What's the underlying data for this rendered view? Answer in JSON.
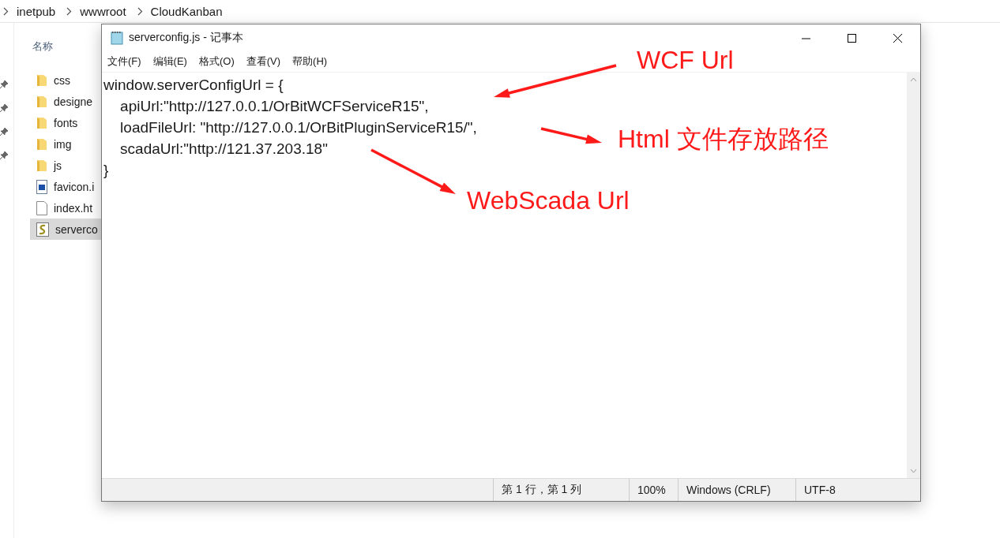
{
  "explorer": {
    "breadcrumb": [
      "inetpub",
      "wwwroot",
      "CloudKanban"
    ],
    "column_header": "名称",
    "files": [
      {
        "name": "css",
        "kind": "folder",
        "selected": false
      },
      {
        "name": "designe",
        "kind": "folder",
        "selected": false
      },
      {
        "name": "fonts",
        "kind": "folder",
        "selected": false
      },
      {
        "name": "img",
        "kind": "folder",
        "selected": false
      },
      {
        "name": "js",
        "kind": "folder",
        "selected": false
      },
      {
        "name": "favicon.i",
        "kind": "image",
        "selected": false
      },
      {
        "name": "index.ht",
        "kind": "file",
        "selected": false
      },
      {
        "name": "serverco",
        "kind": "script",
        "selected": true
      }
    ]
  },
  "notepad": {
    "title": "serverconfig.js - 记事本",
    "menu": [
      "文件(F)",
      "编辑(E)",
      "格式(O)",
      "查看(V)",
      "帮助(H)"
    ],
    "lines": [
      "window.serverConfigUrl = {",
      "    apiUrl:\"http://127.0.0.1/OrBitWCFServiceR15\",",
      "    loadFileUrl: \"http://127.0.0.1/OrBitPluginServiceR15/\",",
      "    scadaUrl:\"http://121.37.203.18\"",
      "}"
    ],
    "status_bar": [
      "第 1 行，第 1 列",
      "100%",
      "Windows (CRLF)",
      "UTF-8"
    ]
  },
  "annotations": [
    {
      "text": "WCF Url"
    },
    {
      "text": "Html 文件存放路径"
    },
    {
      "text": "WebScada Url"
    }
  ]
}
